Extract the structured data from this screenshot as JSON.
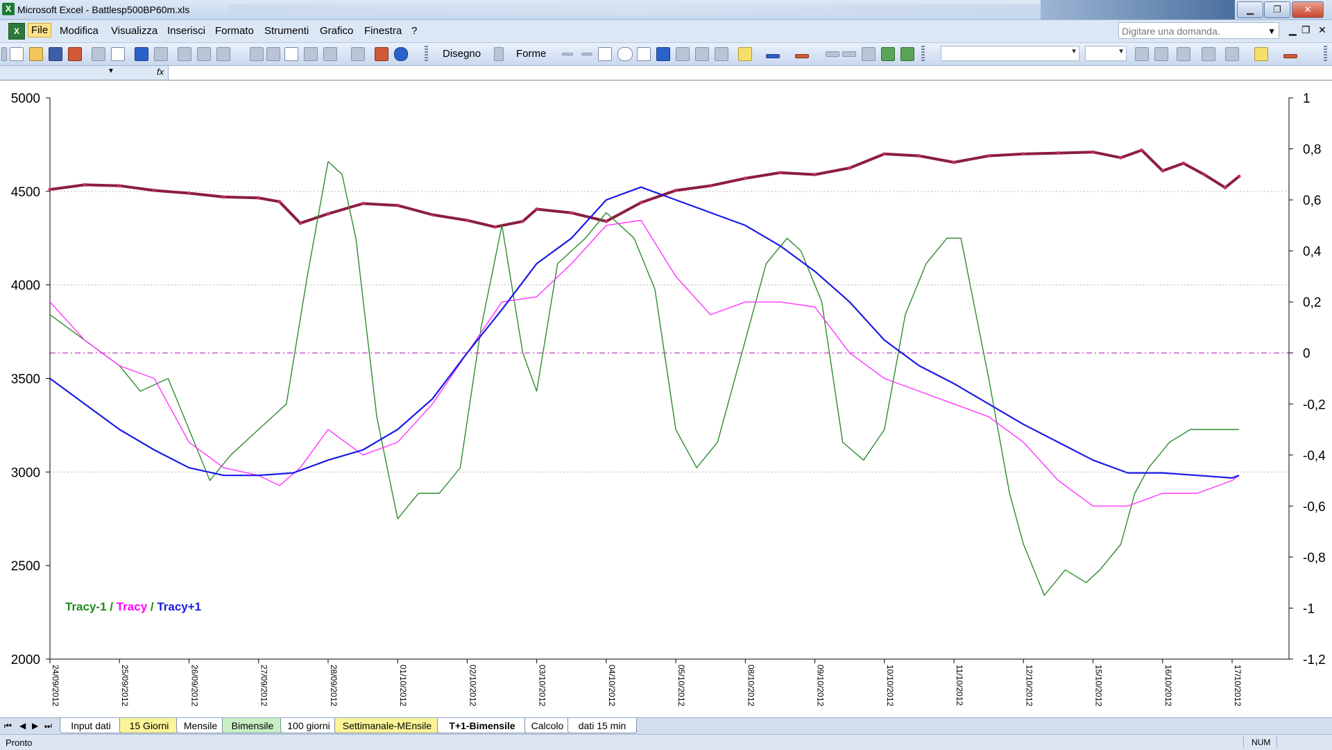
{
  "window": {
    "title": "Microsoft Excel - Battlesp500BP60m.xls"
  },
  "menu": [
    "File",
    "Modifica",
    "Visualizza",
    "Inserisci",
    "Formato",
    "Strumenti",
    "Grafico",
    "Finestra",
    "?"
  ],
  "ask_box": {
    "placeholder": "Digitare una domanda."
  },
  "toolbar": {
    "drawing_label": "Disegno",
    "shapes_label": "Forme"
  },
  "formula": {
    "fx": "fx"
  },
  "sheet_tabs": [
    {
      "label": "Input dati",
      "color": "white"
    },
    {
      "label": "15 Giorni",
      "color": "yellow"
    },
    {
      "label": "Mensile",
      "color": "white"
    },
    {
      "label": "Bimensile",
      "color": "green"
    },
    {
      "label": "100 giorni",
      "color": "white"
    },
    {
      "label": "Settimanale-MEnsile",
      "color": "yellow"
    },
    {
      "label": "T+1-Bimensile",
      "color": "active"
    },
    {
      "label": "Calcolo",
      "color": "white"
    },
    {
      "label": "dati 15 min",
      "color": "white"
    }
  ],
  "status": {
    "left": "Pronto",
    "num": "NUM"
  },
  "chart_data": {
    "type": "line",
    "x_labels": [
      "24/09/2012",
      "25/09/2012",
      "26/09/2012",
      "27/09/2012",
      "28/09/2012",
      "01/10/2012",
      "02/10/2012",
      "03/10/2012",
      "04/10/2012",
      "05/10/2012",
      "08/10/2012",
      "09/10/2012",
      "10/10/2012",
      "11/10/2012",
      "12/10/2012",
      "15/10/2012",
      "16/10/2012",
      "17/10/2012"
    ],
    "y_left": {
      "min": 2000,
      "max": 5000,
      "ticks": [
        "5000",
        "4500",
        "4000",
        "3500",
        "3000",
        "2500",
        "2000"
      ]
    },
    "y_right": {
      "min": -1.2,
      "max": 1,
      "ticks": [
        "1",
        "0,8",
        "0,6",
        "0,4",
        "0,2",
        "0",
        "-0,2",
        "-0,4",
        "-0,6",
        "-0,8",
        "-1",
        "-1,2"
      ]
    },
    "legend": [
      {
        "text": "Tracy-1",
        "color": "#1e8a1e"
      },
      {
        "text": " / ",
        "color": "#1e8a1e"
      },
      {
        "text": "Tracy",
        "color": "#ff00ff"
      },
      {
        "text": " / ",
        "color": "#1e8a1e"
      },
      {
        "text": "Tracy+1",
        "color": "#1a1ae6"
      }
    ],
    "grid_lines_left": [
      4500,
      4000,
      3000
    ],
    "zero_line_right": 0,
    "series": [
      {
        "axis": "left",
        "color": "#8b1e3f",
        "x": [
          0,
          0.5,
          1,
          1.5,
          2,
          2.5,
          3,
          3.3,
          3.6,
          4,
          4.5,
          5,
          5.5,
          6,
          6.4,
          6.8,
          7,
          7.5,
          8,
          8.5,
          9,
          9.5,
          10,
          10.5,
          11,
          11.5,
          12,
          12.5,
          13,
          13.5,
          14,
          14.5,
          15,
          15.4,
          15.7,
          16,
          16.3,
          16.6,
          16.9,
          17.1
        ],
        "values": [
          4510,
          4535,
          4530,
          4505,
          4490,
          4470,
          4465,
          4445,
          4330,
          4380,
          4435,
          4425,
          4375,
          4345,
          4310,
          4340,
          4405,
          4385,
          4340,
          4440,
          4505,
          4530,
          4570,
          4600,
          4590,
          4625,
          4700,
          4690,
          4655,
          4690,
          4700,
          4705,
          4710,
          4680,
          4720,
          4610,
          4650,
          4590,
          4520,
          4580
        ]
      },
      {
        "axis": "right",
        "color": "#2e8b2e",
        "x": [
          0,
          0.5,
          1,
          1.3,
          1.7,
          2,
          2.3,
          2.6,
          3,
          3.4,
          3.7,
          4,
          4.2,
          4.4,
          4.7,
          5,
          5.3,
          5.6,
          5.9,
          6.2,
          6.5,
          6.8,
          7,
          7.3,
          7.7,
          8,
          8.4,
          8.7,
          9,
          9.3,
          9.6,
          10,
          10.3,
          10.6,
          10.8,
          11.1,
          11.4,
          11.7,
          12,
          12.3,
          12.6,
          12.9,
          13.1,
          13.5,
          13.8,
          14,
          14.3,
          14.6,
          14.9,
          15.1,
          15.4,
          15.6,
          15.8,
          16.1,
          16.4,
          16.7,
          16.9,
          17.1
        ],
        "values": [
          0.15,
          0.05,
          -0.05,
          -0.15,
          -0.1,
          -0.3,
          -0.5,
          -0.4,
          -0.3,
          -0.2,
          0.3,
          0.75,
          0.7,
          0.45,
          -0.25,
          -0.65,
          -0.55,
          -0.55,
          -0.45,
          0.1,
          0.5,
          0,
          -0.15,
          0.35,
          0.45,
          0.55,
          0.45,
          0.25,
          -0.3,
          -0.45,
          -0.35,
          0.05,
          0.35,
          0.45,
          0.4,
          0.2,
          -0.35,
          -0.42,
          -0.3,
          0.15,
          0.35,
          0.45,
          0.45,
          -0.1,
          -0.55,
          -0.75,
          -0.95,
          -0.85,
          -0.9,
          -0.85,
          -0.75,
          -0.55,
          -0.45,
          -0.35,
          -0.3,
          -0.3,
          -0.3,
          -0.3
        ]
      },
      {
        "axis": "right",
        "color": "#ff33ff",
        "x": [
          0,
          0.5,
          1,
          1.5,
          2,
          2.5,
          3,
          3.3,
          3.6,
          4,
          4.5,
          5,
          5.5,
          6,
          6.5,
          7,
          7.5,
          8,
          8.5,
          9,
          9.5,
          10,
          10.5,
          11,
          11.5,
          12,
          12.5,
          13,
          13.5,
          14,
          14.5,
          15,
          15.5,
          16,
          16.5,
          17,
          17.1
        ],
        "values": [
          0.2,
          0.05,
          -0.05,
          -0.1,
          -0.35,
          -0.45,
          -0.48,
          -0.52,
          -0.45,
          -0.3,
          -0.4,
          -0.35,
          -0.2,
          0,
          0.2,
          0.22,
          0.35,
          0.5,
          0.52,
          0.3,
          0.15,
          0.2,
          0.2,
          0.18,
          0,
          -0.1,
          -0.15,
          -0.2,
          -0.25,
          -0.35,
          -0.5,
          -0.6,
          -0.6,
          -0.55,
          -0.55,
          -0.5,
          -0.48
        ]
      },
      {
        "axis": "right",
        "color": "#1a1ae6",
        "x": [
          0,
          0.5,
          1,
          1.5,
          2,
          2.5,
          3,
          3.5,
          4,
          4.5,
          5,
          5.5,
          6,
          6.5,
          7,
          7.5,
          8,
          8.5,
          9,
          9.5,
          10,
          10.5,
          11,
          11.5,
          12,
          12.5,
          13,
          13.5,
          14,
          14.5,
          15,
          15.5,
          16,
          16.5,
          17,
          17.1
        ],
        "values": [
          -0.1,
          -0.2,
          -0.3,
          -0.38,
          -0.45,
          -0.48,
          -0.48,
          -0.47,
          -0.42,
          -0.38,
          -0.3,
          -0.18,
          0,
          0.17,
          0.35,
          0.45,
          0.6,
          0.65,
          0.6,
          0.55,
          0.5,
          0.42,
          0.32,
          0.2,
          0.05,
          -0.05,
          -0.12,
          -0.2,
          -0.28,
          -0.35,
          -0.42,
          -0.47,
          -0.47,
          -0.48,
          -0.49,
          -0.48
        ]
      }
    ]
  }
}
